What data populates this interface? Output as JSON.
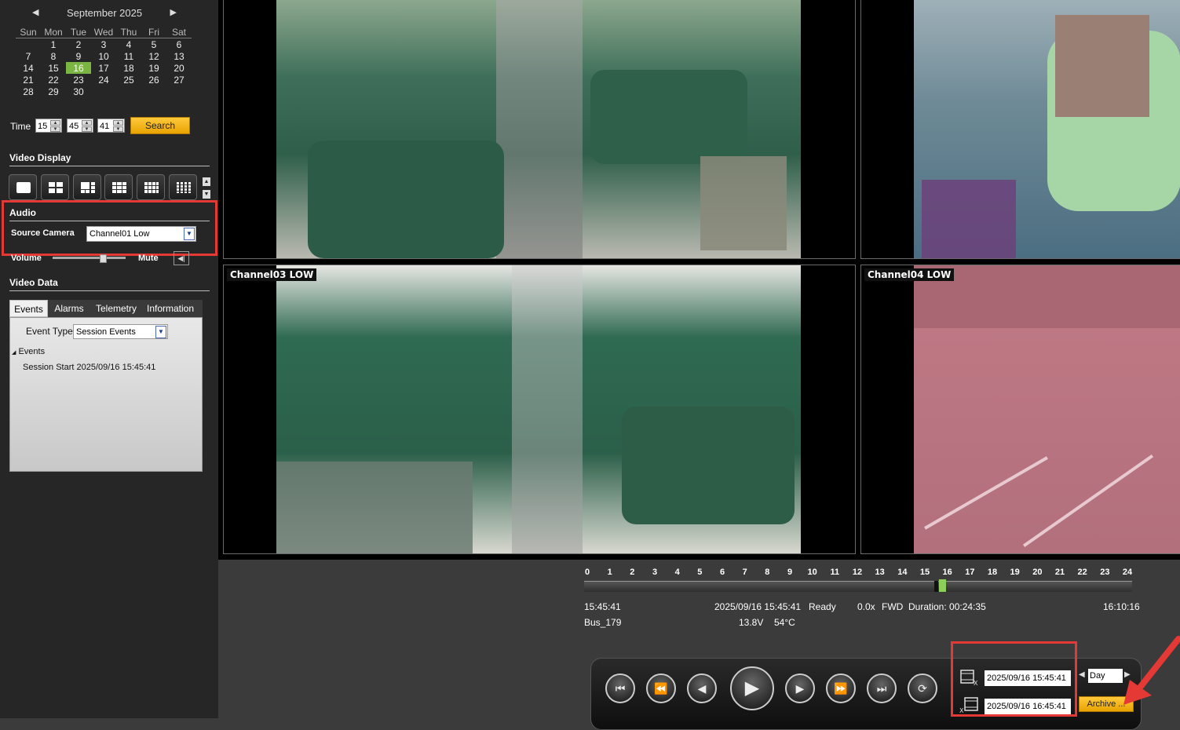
{
  "calendar": {
    "month_label": "September 2025",
    "prev": "◀",
    "next": "▶",
    "weekdays": [
      "Sun",
      "Mon",
      "Tue",
      "Wed",
      "Thu",
      "Fri",
      "Sat"
    ],
    "weeks": [
      [
        "",
        "1",
        "2",
        "3",
        "4",
        "5",
        "6"
      ],
      [
        "7",
        "8",
        "9",
        "10",
        "11",
        "12",
        "13"
      ],
      [
        "14",
        "15",
        "16",
        "17",
        "18",
        "19",
        "20"
      ],
      [
        "21",
        "22",
        "23",
        "24",
        "25",
        "26",
        "27"
      ],
      [
        "28",
        "29",
        "30",
        "",
        "",
        "",
        ""
      ]
    ],
    "selected_day": "16"
  },
  "time": {
    "label": "Time",
    "hour": "15",
    "minute": "45",
    "second": "41",
    "search_label": "Search"
  },
  "video_display": {
    "title": "Video Display"
  },
  "audio": {
    "title": "Audio",
    "source_label": "Source Camera",
    "source_value": "Channel01 Low",
    "volume_label": "Volume",
    "mute_label": "Mute"
  },
  "video_data": {
    "title": "Video Data",
    "tabs": [
      "Events",
      "Alarms",
      "Telemetry",
      "Information"
    ],
    "active_tab": "Events",
    "event_type_label": "Event Type:",
    "event_type_value": "Session Events",
    "tree_root": "Events",
    "tree_items": [
      "Session Start 2025/09/16 15:45:41"
    ]
  },
  "channels": {
    "ch3": "Channel03 LOW",
    "ch4": "Channel04 LOW"
  },
  "timeline": {
    "hours": [
      "0",
      "1",
      "2",
      "3",
      "4",
      "5",
      "6",
      "7",
      "8",
      "9",
      "10",
      "11",
      "12",
      "13",
      "14",
      "15",
      "16",
      "17",
      "18",
      "19",
      "20",
      "21",
      "22",
      "23",
      "24"
    ],
    "current_hour_fraction": 0.6566
  },
  "status": {
    "start_time": "15:45:41",
    "current_datetime": "2025/09/16 15:45:41",
    "state": "Ready",
    "speed": "0.0x",
    "direction": "FWD",
    "duration": "Duration: 00:24:35",
    "end_time": "16:10:16",
    "vehicle": "Bus_179",
    "voltage": "13.8V",
    "temperature": "54°C"
  },
  "controls": {
    "start_date": "2025/09/16 15:45:41",
    "end_date": "2025/09/16 16:45:41",
    "range_value": "Day",
    "archive_label": "Archive ...",
    "icons": [
      "skip-start",
      "fast-rewind",
      "step-back",
      "play",
      "step-forward",
      "fast-forward",
      "skip-end",
      "loop"
    ]
  },
  "colors": {
    "accent_green": "#7bb642",
    "button_orange": "#f0b000",
    "highlight_red": "#e53935"
  }
}
